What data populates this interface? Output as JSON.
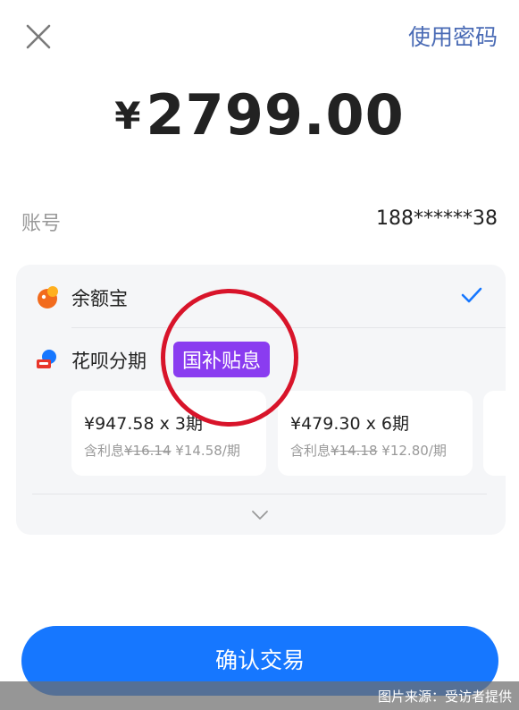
{
  "header": {
    "close_icon": "close-icon",
    "use_password_label": "使用密码"
  },
  "amount": {
    "currency": "¥",
    "value": "2799.00"
  },
  "account": {
    "label": "账号",
    "value": "188******38"
  },
  "payment_methods": {
    "yuebao": {
      "label": "余额宝",
      "icon": "yuebao-icon",
      "selected": true
    },
    "huabei": {
      "label": "花呗分期",
      "icon": "huabei-icon",
      "badge": "国补贴息",
      "plans": [
        {
          "title": "¥947.58 x 3期",
          "interest_prefix": "含利息",
          "old_interest": "¥16.14",
          "new_interest": "¥14.58/期"
        },
        {
          "title": "¥479.30 x 6期",
          "interest_prefix": "含利息",
          "old_interest": "¥14.18",
          "new_interest": "¥12.80/期"
        }
      ]
    }
  },
  "confirm_button_label": "确认交易",
  "image_credit": "图片来源：受访者提供",
  "colors": {
    "accent_blue": "#1677ff",
    "link_blue": "#4a6bb5",
    "badge_purple": "#8a3cf0",
    "annotation_red": "#d8142a"
  }
}
